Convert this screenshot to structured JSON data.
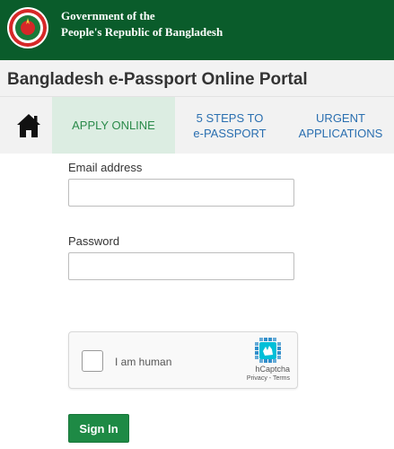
{
  "gov_header": {
    "line1": "Government of the",
    "line2": "People's Republic of Bangladesh",
    "emblem_icon": "bangladesh-emblem-icon",
    "background_color": "#0a5c2b"
  },
  "portal": {
    "title": "Bangladesh e-Passport Online Portal"
  },
  "nav": {
    "home_icon": "home-icon",
    "tabs": [
      {
        "line1": "APPLY ONLINE",
        "line2": "",
        "active": true
      },
      {
        "line1": "5 STEPS TO",
        "line2": "e-PASSPORT",
        "active": false
      },
      {
        "line1": "URGENT",
        "line2": "APPLICATIONS",
        "active": false
      }
    ],
    "active_bg": "#dcede2",
    "active_color": "#2a8a4a",
    "link_color": "#2a6fb0"
  },
  "form": {
    "email_label": "Email address",
    "email_value": "",
    "password_label": "Password",
    "password_value": "",
    "captcha": {
      "checkbox_label": "I am human",
      "brand": "hCaptcha",
      "privacy": "Privacy",
      "separator": " - ",
      "terms": "Terms",
      "logo_icon": "hcaptcha-logo-icon"
    },
    "submit_label": "Sign In",
    "submit_color": "#1e8a45"
  }
}
